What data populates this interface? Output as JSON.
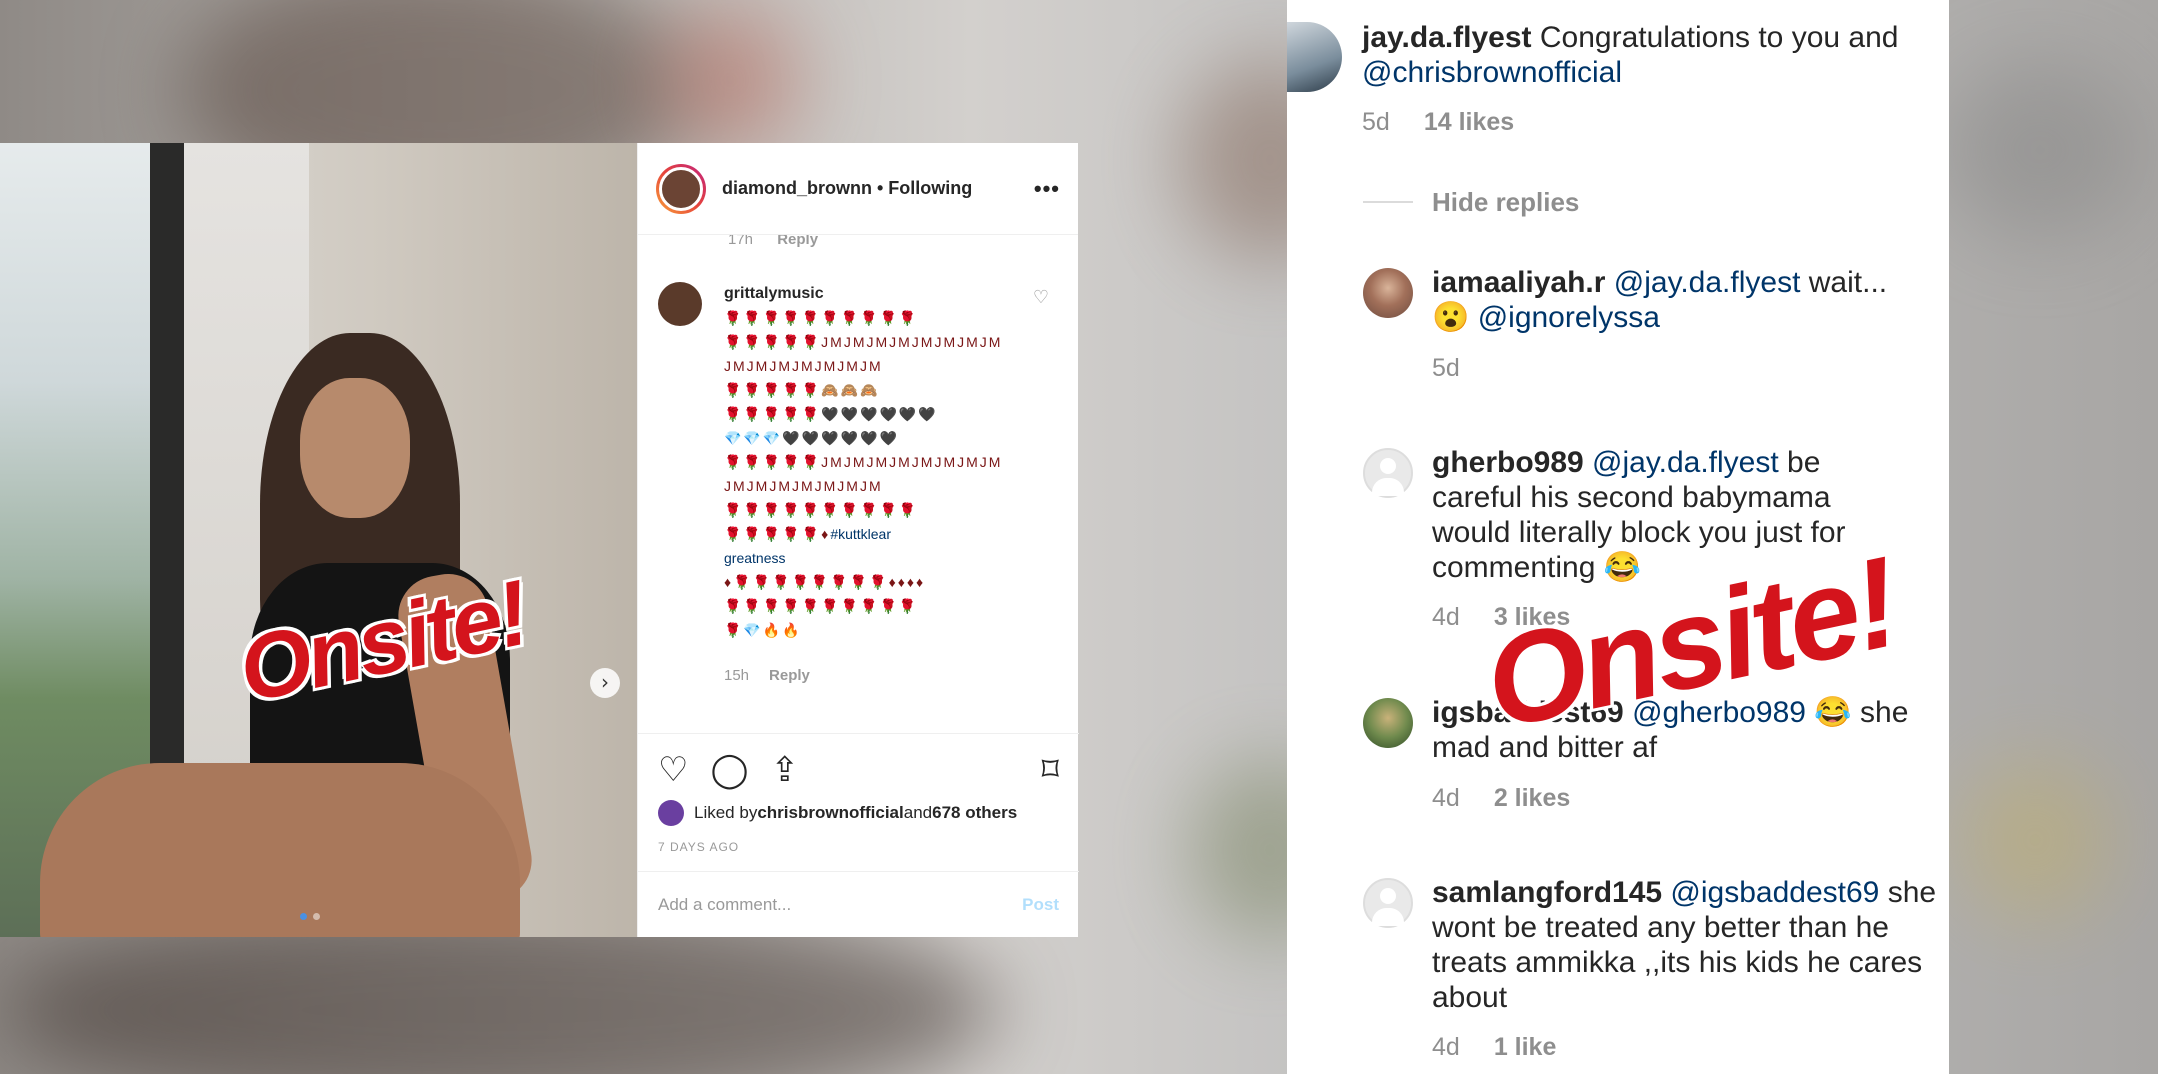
{
  "post": {
    "username": "diamond_brownn • Following",
    "more_icon": "•••",
    "prev_reply_time": "17h",
    "reply_label": "Reply",
    "comment": {
      "username": "grittalymusic",
      "lines": [
        "🌹🌹🌹🌹🌹🌹🌹🌹🌹🌹",
        "🌹🌹🌹🌹🌹JMJMJMJMJMJMJMJM",
        "JMJMJMJMJMJMJM",
        "🌹🌹🌹🌹🌹🙈🙈🙈",
        "🌹🌹🌹🌹🌹🖤🖤🖤🖤🖤🖤",
        "💎💎💎🖤🖤🖤🖤🖤🖤",
        "🌹🌹🌹🌹🌹JMJMJMJMJMJMJMJM",
        "JMJMJMJMJMJMJM",
        "🌹🌹🌹🌹🌹🌹🌹🌹🌹🌹",
        "🌹🌹🌹🌹🌹♦",
        "♦🌹🌹🌹🌹🌹🌹🌹🌹♦♦♦♦",
        "🌹🌹🌹🌹🌹🌹🌹🌹🌹🌹",
        "🌹💎🔥🔥"
      ],
      "hashtag": "#kuttklear",
      "hashtag2": "greatness",
      "time": "15h",
      "reply": "Reply"
    },
    "liked_by_prefix": "Liked by ",
    "liked_by_user": "chrisbrownofficial",
    "liked_by_suffix": " and ",
    "liked_by_count": "678 others",
    "date": "7 DAYS AGO",
    "add_comment_placeholder": "Add a comment...",
    "post_button": "Post"
  },
  "watermark": "Onsite!",
  "thread": {
    "top": {
      "username": "jay.da.flyest",
      "text": " Congratulations to you and",
      "mention": "@chrisbrownofficial",
      "time": "5d",
      "likes": "14 likes"
    },
    "hide_replies": "Hide replies",
    "replies": [
      {
        "username": "iamaaliyah.r",
        "mention": " @jay.da.flyest",
        "text": " wait...",
        "line2_emoji": "😮",
        "mention2": " @ignorelyssa",
        "time": "5d",
        "likes": ""
      },
      {
        "username": "gherbo989",
        "mention": " @jay.da.flyest",
        "text": " be careful his second babymama would literally block you just for commenting 😂",
        "time": "4d",
        "likes": "3 likes"
      },
      {
        "username": "igsbaddest69",
        "mention": " @gherbo989",
        "text": " 😂 she mad and bitter  af",
        "time": "4d",
        "likes": "2 likes"
      },
      {
        "username": "samlangford145",
        "mention": " @igsbaddest69",
        "text": " she wont be treated any better than he treats ammikka ,,its his kids he cares about",
        "time": "4d",
        "likes": "1 like"
      }
    ]
  }
}
